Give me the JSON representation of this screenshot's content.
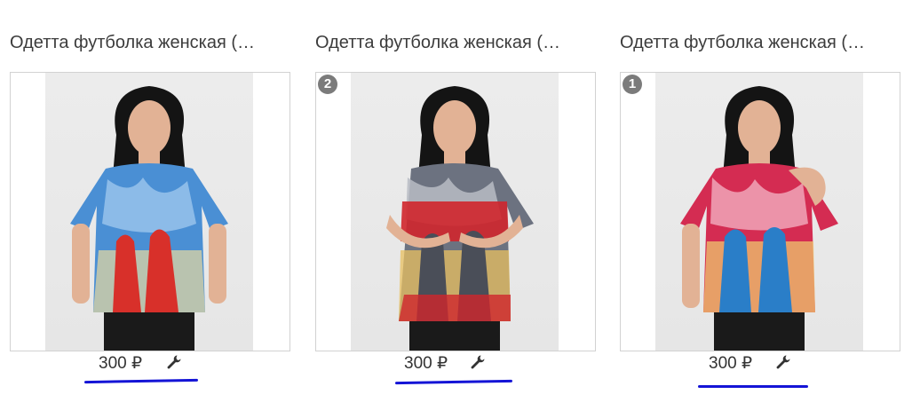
{
  "products": [
    {
      "title": "Одетта футболка женская (…",
      "price": "300 ₽",
      "badge": "",
      "shirt_colors": [
        "#4a8fd4",
        "#9cc6ec",
        "#d8302a"
      ]
    },
    {
      "title": "Одетта футболка женская (…",
      "price": "300 ₽",
      "badge": "2",
      "shirt_colors": [
        "#6c7280",
        "#b8bcc4",
        "#d0262c"
      ]
    },
    {
      "title": "Одетта футболка женская (…",
      "price": "300 ₽",
      "badge": "1",
      "shirt_colors": [
        "#d42c52",
        "#f0a6b8",
        "#2a7ec8"
      ]
    }
  ],
  "icons": {
    "tool": "wrench-icon"
  },
  "accent_underline": "#1414d6"
}
